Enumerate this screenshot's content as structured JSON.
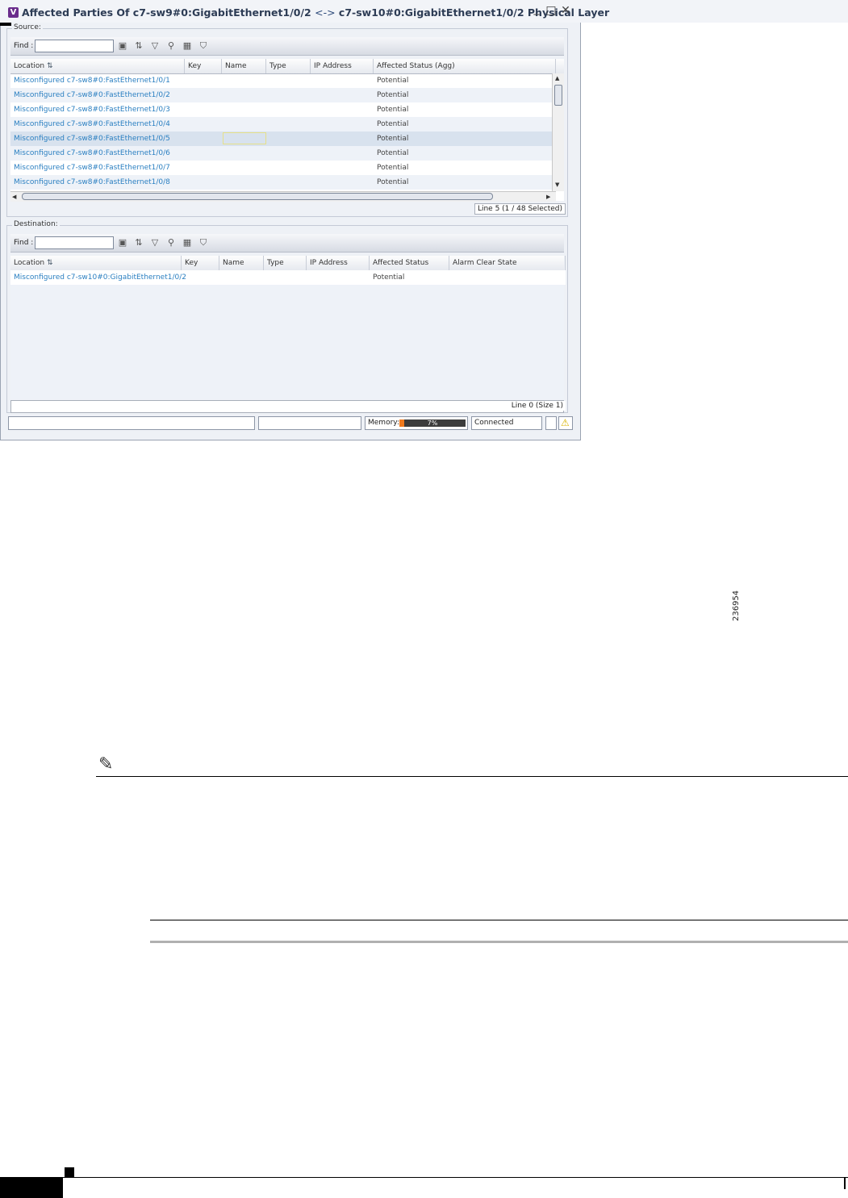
{
  "window": {
    "title_prefix": "Affected Parties Of c7-sw9#0:GigabitEthernet1/0/2",
    "title_arrow": "<->",
    "title_suffix": "c7-sw10#0:GigabitEthernet1/0/2 Physical Layer",
    "app_badge": "V",
    "minimize_glyph": "_",
    "maximize_glyph": "□",
    "close_glyph": "✕"
  },
  "source": {
    "group_label": "Source:",
    "find_label": "Find :",
    "find_value": "",
    "columns": [
      "Location",
      "Key",
      "Name",
      "Type",
      "IP Address",
      "Affected Status (Agg)"
    ],
    "rows": [
      {
        "location": "Misconfigured c7-sw8#0:FastEthernet1/0/1",
        "status": "Potential"
      },
      {
        "location": "Misconfigured c7-sw8#0:FastEthernet1/0/2",
        "status": "Potential"
      },
      {
        "location": "Misconfigured c7-sw8#0:FastEthernet1/0/3",
        "status": "Potential"
      },
      {
        "location": "Misconfigured c7-sw8#0:FastEthernet1/0/4",
        "status": "Potential"
      },
      {
        "location": "Misconfigured c7-sw8#0:FastEthernet1/0/5",
        "status": "Potential"
      },
      {
        "location": "Misconfigured c7-sw8#0:FastEthernet1/0/6",
        "status": "Potential"
      },
      {
        "location": "Misconfigured c7-sw8#0:FastEthernet1/0/7",
        "status": "Potential"
      },
      {
        "location": "Misconfigured c7-sw8#0:FastEthernet1/0/8",
        "status": "Potential"
      }
    ],
    "line_info": "Line 5 (1 / 48 Selected)"
  },
  "destination": {
    "group_label": "Destination:",
    "find_label": "Find :",
    "find_value": "",
    "columns": [
      "Location",
      "Key",
      "Name",
      "Type",
      "IP Address",
      "Affected Status",
      "Alarm Clear State"
    ],
    "rows": [
      {
        "location": "Misconfigured c7-sw10#0:GigabitEthernet1/0/2",
        "status": "Potential"
      }
    ],
    "line_info": "Line 0 (Size 1)"
  },
  "statusbar": {
    "memory_label": "Memory:",
    "memory_percent": "7%",
    "memory_fraction": 0.07,
    "connection": "Connected"
  },
  "figure_id": "236954",
  "colors": {
    "link": "#2a7fc1",
    "title": "#2d3c55",
    "memory_bar": "#3c3c3c",
    "memory_fill": "#f07a1e",
    "warning": "#f2d21b"
  }
}
